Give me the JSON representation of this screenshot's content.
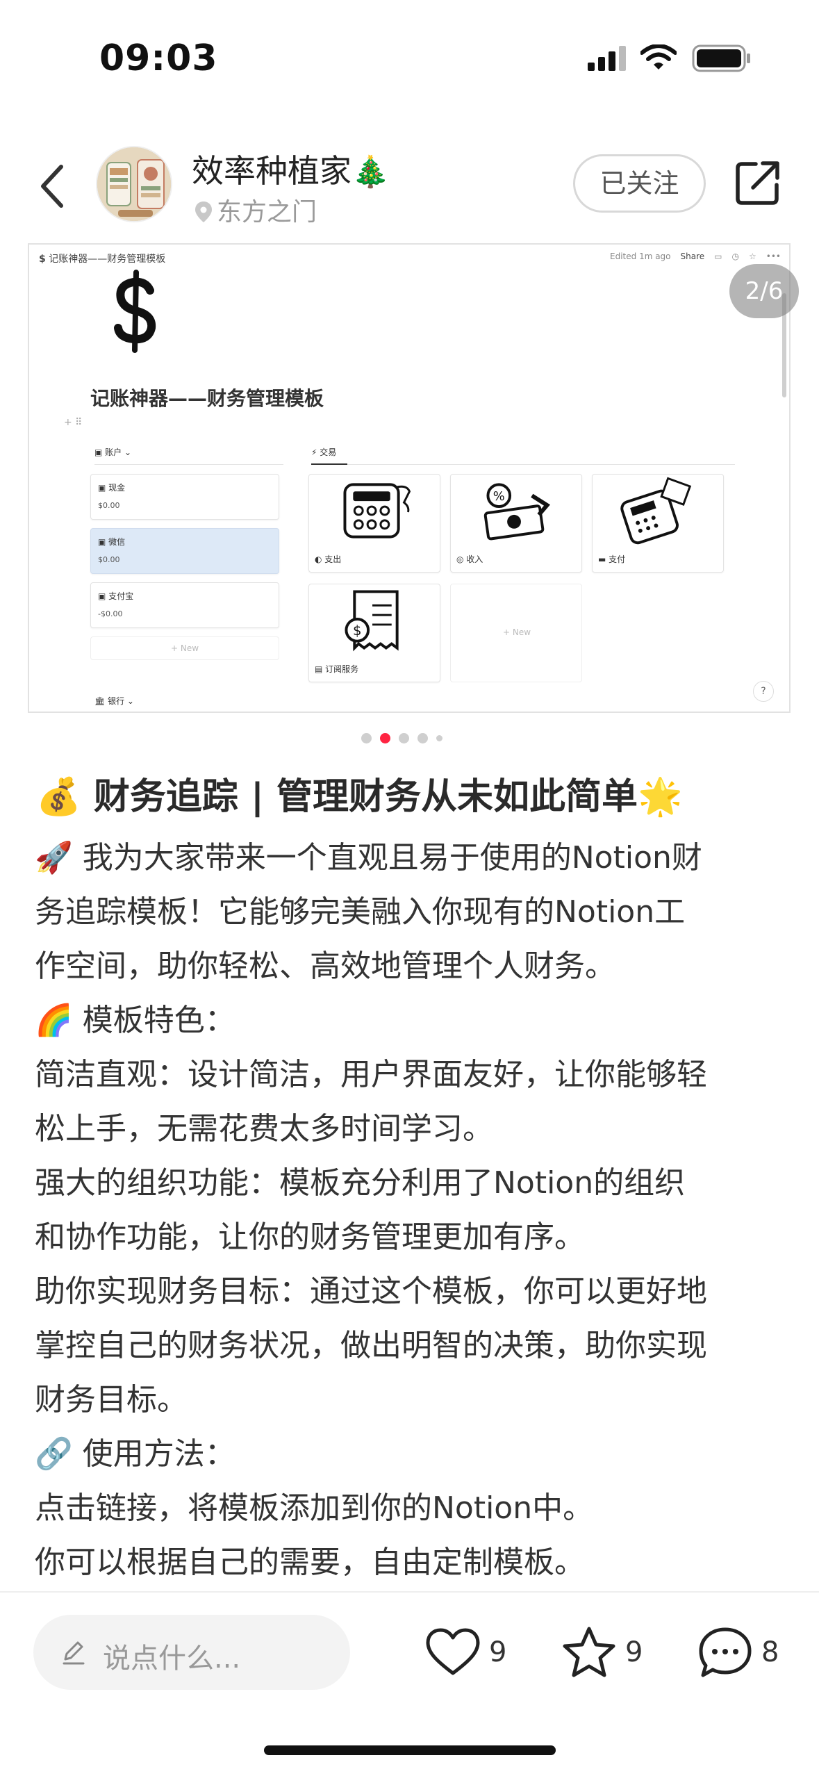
{
  "status_bar": {
    "time": "09:03"
  },
  "header": {
    "author_name": "效率种植家",
    "author_emoji": "🎄",
    "location": "东方之门",
    "follow_label": "已关注"
  },
  "carousel": {
    "counter": "2/6",
    "dot_count": 5,
    "active_dot": 1,
    "notion": {
      "breadcrumb": "记账神器——财务管理模板",
      "edited": "Edited 1m ago",
      "share": "Share",
      "title": "记账神器——财务管理模板",
      "accounts_header": "账户",
      "transactions_header": "交易",
      "accounts": [
        {
          "label": "现金",
          "amount": "$0.00"
        },
        {
          "label": "微信",
          "amount": "$0.00"
        },
        {
          "label": "支付宝",
          "amount": "-$0.00"
        }
      ],
      "new_label": "+ New",
      "gallery": [
        {
          "caption": "支出",
          "art": "calculator"
        },
        {
          "caption": "收入",
          "art": "money"
        },
        {
          "caption": "支付",
          "art": "card-terminal"
        },
        {
          "caption": "订阅服务",
          "art": "receipt"
        }
      ],
      "bank_header": "银行",
      "help": "?"
    }
  },
  "post": {
    "title": "💰 财务追踪 | 管理财务从未如此简单🌟",
    "lines": [
      "🚀 我为大家带来一个直观且易于使用的Notion财",
      "务追踪模板！它能够完美融入你现有的Notion工",
      "作空间，助你轻松、高效地管理个人财务。",
      "🌈 模板特色：",
      "简洁直观：设计简洁，用户界面友好，让你能够轻",
      "松上手，无需花费太多时间学习。",
      "强大的组织功能：模板充分利用了Notion的组织",
      "和协作功能，让你的财务管理更加有序。",
      "助你实现财务目标：通过这个模板，你可以更好地",
      "掌控自己的财务状况，做出明智的决策，助你实现",
      "财务目标。",
      "🔗 使用方法：",
      "点击链接，将模板添加到你的Notion中。",
      "你可以根据自己的需要，自由定制模板。"
    ]
  },
  "bottom_bar": {
    "comment_placeholder": "说点什么...",
    "likes": "9",
    "stars": "9",
    "comments": "8"
  }
}
